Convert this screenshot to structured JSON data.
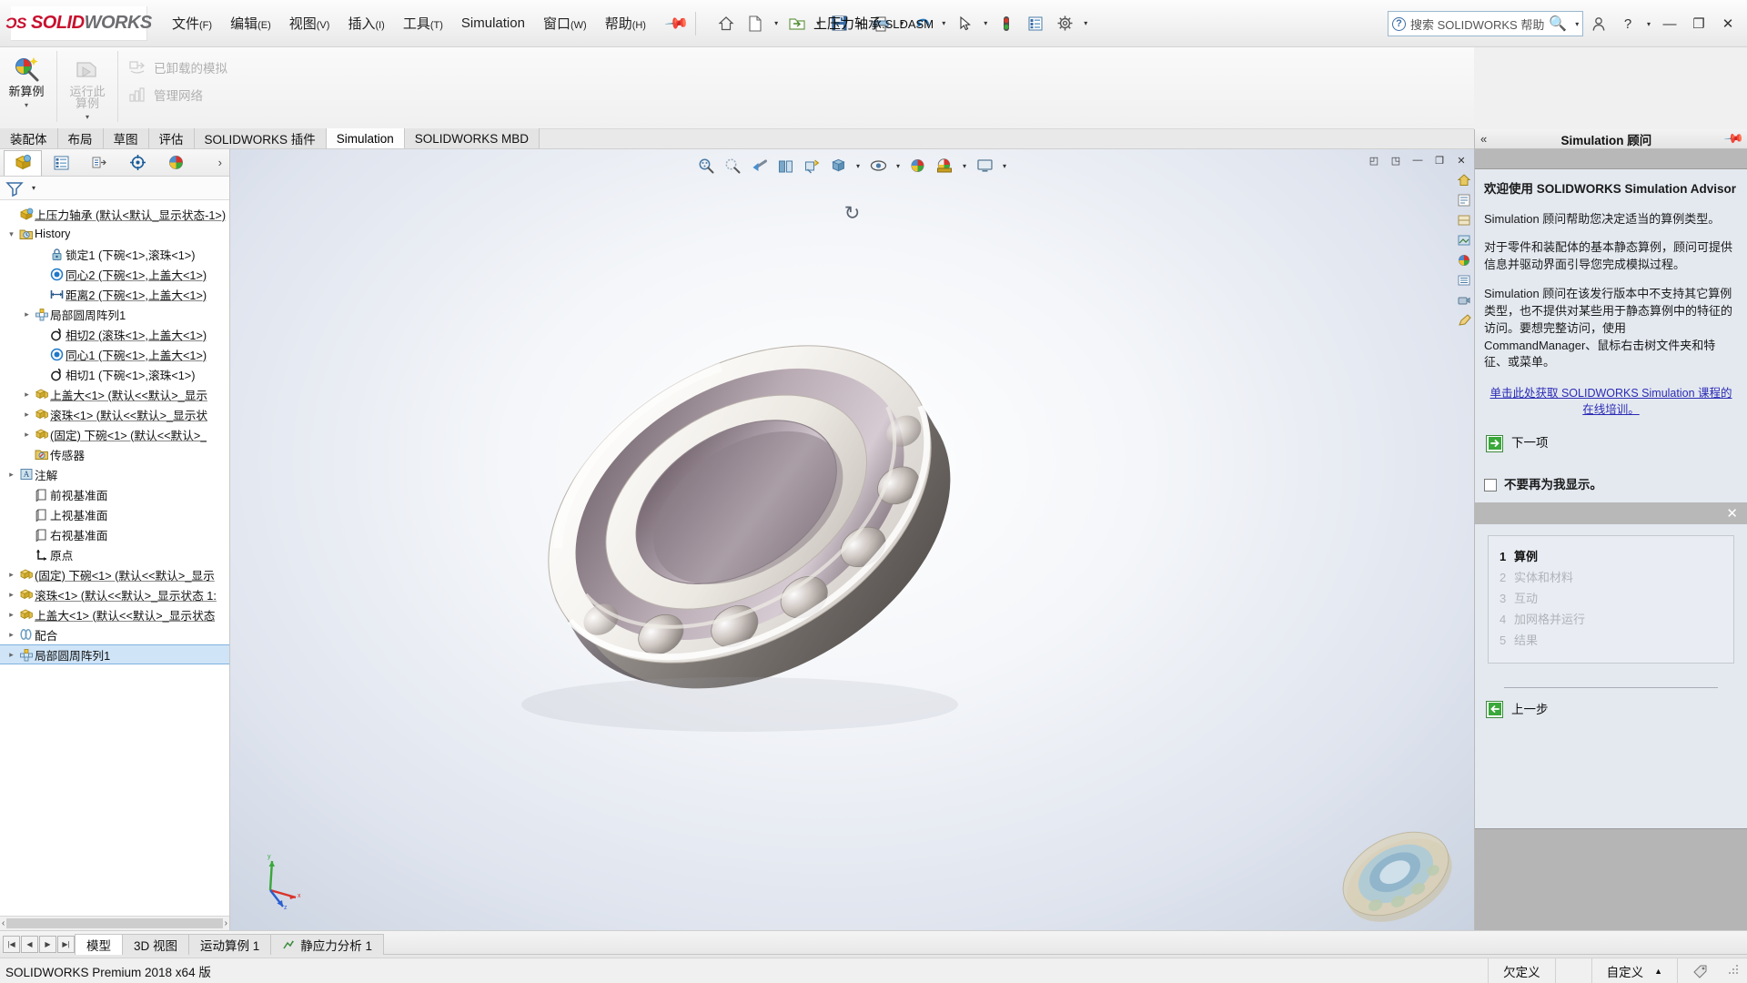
{
  "app": {
    "brand": "SOLIDWORKS",
    "brand_prefix": "DS",
    "document_title": "上压力轴承",
    "document_ext": ".SLDASM",
    "status_text": "SOLIDWORKS Premium 2018 x64 版"
  },
  "menu": {
    "items": [
      {
        "label": "文件",
        "mnemonic": "(F)"
      },
      {
        "label": "编辑",
        "mnemonic": "(E)"
      },
      {
        "label": "视图",
        "mnemonic": "(V)"
      },
      {
        "label": "插入",
        "mnemonic": "(I)"
      },
      {
        "label": "工具",
        "mnemonic": "(T)"
      },
      {
        "label": "Simulation",
        "mnemonic": ""
      },
      {
        "label": "窗口",
        "mnemonic": "(W)"
      },
      {
        "label": "帮助",
        "mnemonic": "(H)"
      }
    ],
    "pin": "pin-icon"
  },
  "quick_access": {
    "buttons": [
      {
        "name": "home-icon",
        "has_caret": false
      },
      {
        "name": "new-document-icon",
        "has_caret": true
      },
      {
        "name": "open-folder-icon",
        "has_caret": true
      },
      {
        "name": "save-icon",
        "has_caret": true
      },
      {
        "name": "print-icon",
        "has_caret": true
      },
      {
        "name": "undo-icon",
        "has_caret": true
      },
      {
        "name": "select-cursor-icon",
        "has_caret": true
      },
      {
        "name": "rebuild-traffic-light-icon",
        "has_caret": false
      },
      {
        "name": "file-properties-icon",
        "has_caret": false
      },
      {
        "name": "options-gear-icon",
        "has_caret": true
      }
    ]
  },
  "search": {
    "placeholder": "搜索 SOLIDWORKS 帮助",
    "help_label": "?"
  },
  "window_buttons": {
    "minimize": "—",
    "restore": "❐",
    "close": "✕"
  },
  "ribbon": {
    "big_buttons": [
      {
        "label_line1": "新算例",
        "label_line2": "",
        "name": "new-study-button",
        "disabled": false,
        "has_dropdown": true
      },
      {
        "label_line1": "运行此",
        "label_line2": "算例",
        "name": "run-this-study-button",
        "disabled": true,
        "has_dropdown": true
      }
    ],
    "small_buttons": [
      {
        "label": "已卸载的模拟",
        "name": "offloaded-simulation-button"
      },
      {
        "label": "管理网络",
        "name": "manage-network-button"
      }
    ]
  },
  "command_tabs": [
    {
      "label": "装配体",
      "active": false
    },
    {
      "label": "布局",
      "active": false
    },
    {
      "label": "草图",
      "active": false
    },
    {
      "label": "评估",
      "active": false
    },
    {
      "label": "SOLIDWORKS 插件",
      "active": false
    },
    {
      "label": "Simulation",
      "active": true
    },
    {
      "label": "SOLIDWORKS MBD",
      "active": false
    }
  ],
  "feature_manager": {
    "tabs": [
      {
        "name": "feature-manager-tab",
        "active": true
      },
      {
        "name": "property-manager-tab",
        "active": false
      },
      {
        "name": "configuration-manager-tab",
        "active": false
      },
      {
        "name": "dimxpert-manager-tab",
        "active": false
      },
      {
        "name": "display-manager-tab",
        "active": false
      }
    ],
    "expand_label": "›",
    "filter_name": "filter-icon",
    "tree": [
      {
        "depth": 0,
        "twist": "",
        "icon": "assembly-icon",
        "label": "上压力轴承  (默认<默认_显示状态-1>)",
        "underline": true,
        "selected": false
      },
      {
        "depth": 0,
        "twist": "▾",
        "icon": "history-icon",
        "label": "History",
        "underline": false,
        "selected": false
      },
      {
        "depth": 2,
        "twist": "",
        "icon": "lock-mate-icon",
        "label": "锁定1 (下碗<1>,滚珠<1>)",
        "underline": false,
        "selected": false
      },
      {
        "depth": 2,
        "twist": "",
        "icon": "concentric-mate-icon",
        "label": "同心2 (下碗<1>,上盖大<1>)",
        "underline": true,
        "selected": false
      },
      {
        "depth": 2,
        "twist": "",
        "icon": "distance-mate-icon",
        "label": "距离2 (下碗<1>,上盖大<1>)",
        "underline": true,
        "selected": false
      },
      {
        "depth": 1,
        "twist": "▸",
        "icon": "pattern-icon",
        "label": "局部圆周阵列1",
        "underline": false,
        "selected": false
      },
      {
        "depth": 2,
        "twist": "",
        "icon": "tangent-mate-icon",
        "label": "相切2 (滚珠<1>,上盖大<1>)",
        "underline": true,
        "selected": false
      },
      {
        "depth": 2,
        "twist": "",
        "icon": "concentric-mate-icon",
        "label": "同心1 (下碗<1>,上盖大<1>)",
        "underline": true,
        "selected": false
      },
      {
        "depth": 2,
        "twist": "",
        "icon": "tangent-mate-icon",
        "label": "相切1 (下碗<1>,滚珠<1>)",
        "underline": false,
        "selected": false
      },
      {
        "depth": 1,
        "twist": "▸",
        "icon": "component-icon",
        "label": "上盖大<1>  (默认<<默认>_显示",
        "underline": true,
        "selected": false
      },
      {
        "depth": 1,
        "twist": "▸",
        "icon": "component-icon",
        "label": "滚珠<1>  (默认<<默认>_显示状",
        "underline": true,
        "selected": false
      },
      {
        "depth": 1,
        "twist": "▸",
        "icon": "component-icon",
        "label": "(固定) 下碗<1>  (默认<<默认>_",
        "underline": true,
        "selected": false
      },
      {
        "depth": 1,
        "twist": "",
        "icon": "sensor-icon",
        "label": "传感器",
        "underline": false,
        "selected": false
      },
      {
        "depth": 0,
        "twist": "▸",
        "icon": "annotations-icon",
        "label": "注解",
        "underline": false,
        "selected": false
      },
      {
        "depth": 1,
        "twist": "",
        "icon": "plane-icon",
        "label": "前视基准面",
        "underline": false,
        "selected": false
      },
      {
        "depth": 1,
        "twist": "",
        "icon": "plane-icon",
        "label": "上视基准面",
        "underline": false,
        "selected": false
      },
      {
        "depth": 1,
        "twist": "",
        "icon": "plane-icon",
        "label": "右视基准面",
        "underline": false,
        "selected": false
      },
      {
        "depth": 1,
        "twist": "",
        "icon": "origin-icon",
        "label": "原点",
        "underline": false,
        "selected": false
      },
      {
        "depth": 0,
        "twist": "▸",
        "icon": "component-icon",
        "label": "(固定) 下碗<1>  (默认<<默认>_显示",
        "underline": true,
        "selected": false
      },
      {
        "depth": 0,
        "twist": "▸",
        "icon": "component-icon",
        "label": "滚珠<1>  (默认<<默认>_显示状态 1:",
        "underline": true,
        "selected": false
      },
      {
        "depth": 0,
        "twist": "▸",
        "icon": "component-icon",
        "label": "上盖大<1>  (默认<<默认>_显示状态",
        "underline": true,
        "selected": false
      },
      {
        "depth": 0,
        "twist": "▸",
        "icon": "mates-folder-icon",
        "label": "配合",
        "underline": false,
        "selected": false
      },
      {
        "depth": 0,
        "twist": "▸",
        "icon": "pattern-icon",
        "label": "局部圆周阵列1",
        "underline": false,
        "selected": true
      }
    ]
  },
  "graphics": {
    "heads_up_toolbar": [
      {
        "name": "zoom-to-fit-icon",
        "has_caret": false
      },
      {
        "name": "zoom-to-area-icon",
        "has_caret": false
      },
      {
        "name": "previous-view-icon",
        "has_caret": false
      },
      {
        "name": "section-view-icon",
        "has_caret": false
      },
      {
        "name": "view-orientation-icon",
        "has_caret": false
      },
      {
        "name": "display-style-icon",
        "has_caret": true
      },
      {
        "name": "hide-show-items-icon",
        "has_caret": true
      },
      {
        "name": "edit-appearance-icon",
        "has_caret": false
      },
      {
        "name": "apply-scene-icon",
        "has_caret": true
      },
      {
        "name": "view-settings-icon",
        "has_caret": true
      }
    ],
    "window_buttons": [
      {
        "name": "restore-left-icon",
        "label": "◰"
      },
      {
        "name": "restore-right-icon",
        "label": "◳"
      },
      {
        "name": "minimize-doc-icon",
        "label": "—"
      },
      {
        "name": "restore-doc-icon",
        "label": "❐"
      },
      {
        "name": "close-doc-icon",
        "label": "✕"
      }
    ],
    "rotation_indicator": "↻",
    "triad_labels": {
      "x": "x",
      "y": "y",
      "z": "z"
    },
    "right_tools": [
      {
        "name": "view-home-icon"
      },
      {
        "name": "view-section-icon"
      },
      {
        "name": "view-display-icon"
      },
      {
        "name": "view-scene-icon"
      },
      {
        "name": "view-appearance-icon"
      },
      {
        "name": "view-list-icon"
      },
      {
        "name": "view-camera-icon"
      },
      {
        "name": "view-sketch-icon"
      }
    ]
  },
  "advisor": {
    "title": "Simulation 顾问",
    "collapse_label": "«",
    "heading_cn": "欢迎使用",
    "heading_en": "SOLIDWORKS Simulation Advisor",
    "paragraph1": "Simulation 顾问帮助您决定适当的算例类型。",
    "paragraph2": "对于零件和装配体的基本静态算例，顾问可提供信息并驱动界面引导您完成模拟过程。",
    "paragraph3": "Simulation 顾问在该发行版本中不支持其它算例类型，也不提供对某些用于静态算例中的特征的访问。要想完整访问，使用 CommandManager、鼠标右击树文件夹和特征、或菜单。",
    "link": "单击此处获取 SOLIDWORKS Simulation 课程的在线培训。",
    "next_label": "下一项",
    "prev_label": "上一步",
    "dont_show_label": "不要再为我显示。",
    "close_label": "✕",
    "steps": [
      {
        "num": "1",
        "label": "算例",
        "active": true
      },
      {
        "num": "2",
        "label": "实体和材料",
        "active": false
      },
      {
        "num": "3",
        "label": "互动",
        "active": false
      },
      {
        "num": "4",
        "label": "加网格并运行",
        "active": false
      },
      {
        "num": "5",
        "label": "结果",
        "active": false
      }
    ]
  },
  "document_tabs": {
    "nav": [
      "|◀",
      "◀",
      "▶",
      "▶|"
    ],
    "tabs": [
      {
        "label": "模型",
        "active": true,
        "icon": ""
      },
      {
        "label": "3D 视图",
        "active": false,
        "icon": ""
      },
      {
        "label": "运动算例 1",
        "active": false,
        "icon": ""
      },
      {
        "label": "静应力分析 1",
        "active": false,
        "icon": "study-icon"
      }
    ]
  },
  "status_bar": {
    "left": "SOLIDWORKS Premium 2018 x64 版",
    "cells": [
      "欠定义",
      "自定义"
    ],
    "caret": "▲"
  },
  "colors": {
    "accent": "#c8102e",
    "link": "#2a2ab4",
    "selection": "#cfe4f7",
    "tab_active": "#fdfdfd",
    "advisor_bg": "#e4e9f0"
  }
}
